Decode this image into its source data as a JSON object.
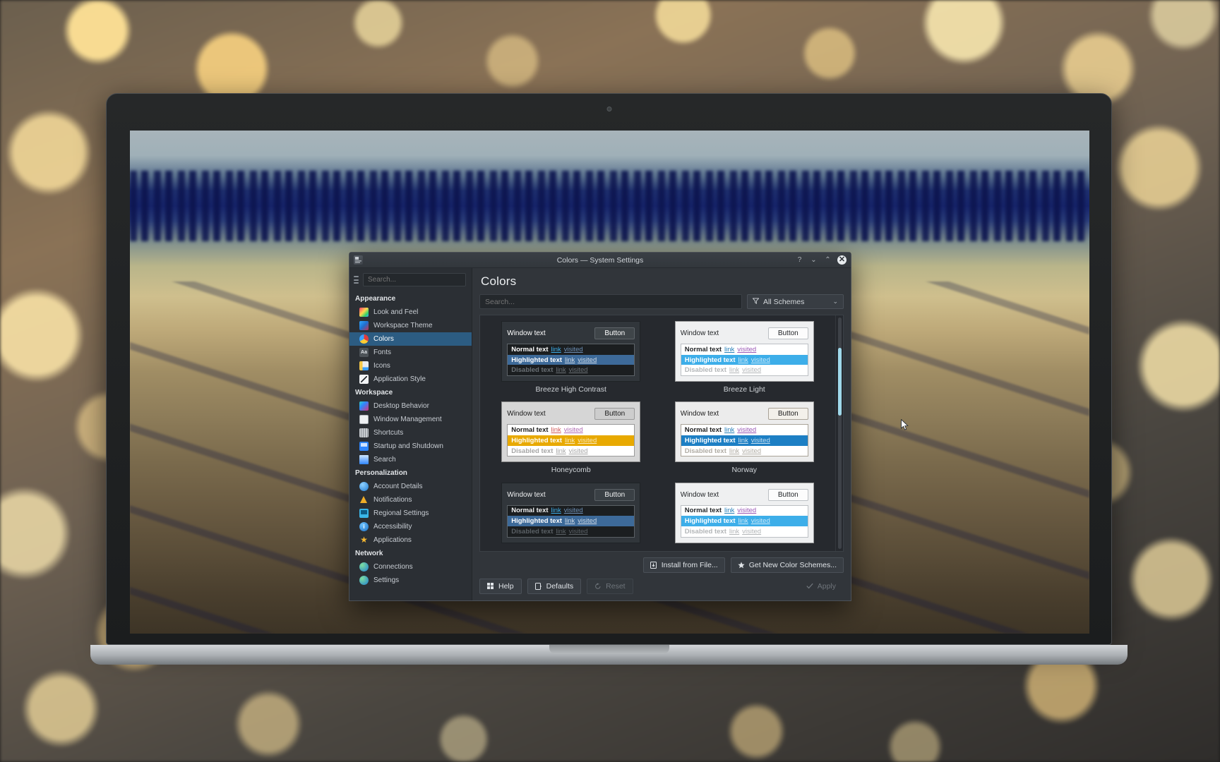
{
  "window": {
    "title": "Colors — System Settings",
    "app_icon": "system-settings-icon",
    "buttons": {
      "help": "?",
      "minimize": "⌄",
      "maximize": "⌃",
      "close": "✕"
    }
  },
  "sidebar": {
    "search_placeholder": "Search...",
    "search_value": "",
    "hamburger": "menu-icon",
    "groups": [
      {
        "label": "Appearance",
        "items": [
          {
            "label": "Look and Feel",
            "icon": "look-and-feel-icon",
            "active": false
          },
          {
            "label": "Workspace Theme",
            "icon": "workspace-theme-icon",
            "active": false
          },
          {
            "label": "Colors",
            "icon": "colors-icon",
            "active": true
          },
          {
            "label": "Fonts",
            "icon": "fonts-icon",
            "active": false
          },
          {
            "label": "Icons",
            "icon": "icons-icon",
            "active": false
          },
          {
            "label": "Application Style",
            "icon": "application-style-icon",
            "active": false
          }
        ]
      },
      {
        "label": "Workspace",
        "items": [
          {
            "label": "Desktop Behavior",
            "icon": "desktop-behavior-icon",
            "active": false
          },
          {
            "label": "Window Management",
            "icon": "window-management-icon",
            "active": false
          },
          {
            "label": "Shortcuts",
            "icon": "shortcuts-icon",
            "active": false
          },
          {
            "label": "Startup and Shutdown",
            "icon": "startup-shutdown-icon",
            "active": false
          },
          {
            "label": "Search",
            "icon": "search-module-icon",
            "active": false
          }
        ]
      },
      {
        "label": "Personalization",
        "items": [
          {
            "label": "Account Details",
            "icon": "account-details-icon",
            "active": false
          },
          {
            "label": "Notifications",
            "icon": "notifications-icon",
            "active": false
          },
          {
            "label": "Regional Settings",
            "icon": "regional-settings-icon",
            "active": false
          },
          {
            "label": "Accessibility",
            "icon": "accessibility-icon",
            "active": false
          },
          {
            "label": "Applications",
            "icon": "applications-icon",
            "active": false
          }
        ]
      },
      {
        "label": "Network",
        "items": [
          {
            "label": "Connections",
            "icon": "connections-icon",
            "active": false
          },
          {
            "label": "Settings",
            "icon": "network-settings-icon",
            "active": false
          }
        ]
      }
    ]
  },
  "main": {
    "page_title": "Colors",
    "search_placeholder": "Search...",
    "search_value": "",
    "filter": {
      "label": "All Schemes",
      "icon": "filter-funnel-icon",
      "chevron": "⌄"
    },
    "preview_labels": {
      "window_text": "Window text",
      "button": "Button",
      "normal": "Normal text",
      "highlighted": "Highlighted text",
      "disabled": "Disabled text",
      "link": "link",
      "visited": "visited"
    },
    "schemes": [
      {
        "name": "Breeze High Contrast",
        "colors": {
          "window_bg": "#31363b",
          "window_fg": "#ffffff",
          "button_bg": "#3f4549",
          "button_fg": "#ffffff",
          "button_border": "#5d6368",
          "view_bg": "#1b1e20",
          "view_border": "#5d6368",
          "normal_fg": "#ffffff",
          "highlight_bg": "#3d6a99",
          "highlight_fg": "#ffffff",
          "disabled_fg": "#6a7075",
          "link": "#3daee9",
          "visited": "#6d8fb5"
        }
      },
      {
        "name": "Breeze Light",
        "colors": {
          "window_bg": "#eff0f1",
          "window_fg": "#232629",
          "button_bg": "#fcfcfc",
          "button_fg": "#232629",
          "button_border": "#bcc0c4",
          "view_bg": "#ffffff",
          "view_border": "#bcc0c4",
          "normal_fg": "#232629",
          "highlight_bg": "#3daee9",
          "highlight_fg": "#ffffff",
          "disabled_fg": "#b3b6b8",
          "link": "#2980b9",
          "visited": "#9b59b6"
        }
      },
      {
        "name": "Honeycomb",
        "colors": {
          "window_bg": "#d6d6d6",
          "window_fg": "#1c1c1c",
          "button_bg": "#cdcdcd",
          "button_fg": "#1c1c1c",
          "button_border": "#9a9a9a",
          "view_bg": "#ffffff",
          "view_border": "#9a9a9a",
          "normal_fg": "#1c1c1c",
          "highlight_bg": "#e8a900",
          "highlight_fg": "#ffffff",
          "disabled_fg": "#a6a6a6",
          "link": "#d15b5b",
          "visited": "#b06ab3"
        }
      },
      {
        "name": "Norway",
        "colors": {
          "window_bg": "#ececec",
          "window_fg": "#1c1c1c",
          "button_bg": "#f3f0ea",
          "button_fg": "#1c1c1c",
          "button_border": "#a9a398",
          "view_bg": "#ffffff",
          "view_border": "#a9a398",
          "normal_fg": "#1c1c1c",
          "highlight_bg": "#1d7fc4",
          "highlight_fg": "#ffffff",
          "disabled_fg": "#b0aca4",
          "link": "#2980b9",
          "visited": "#9b59b6"
        }
      },
      {
        "name": "",
        "colors": {
          "window_bg": "#31363b",
          "window_fg": "#eff0f1",
          "button_bg": "#3a4045",
          "button_fg": "#eff0f1",
          "button_border": "#5a6065",
          "view_bg": "#1b1e20",
          "view_border": "#5a6065",
          "normal_fg": "#eff0f1",
          "highlight_bg": "#3d6a99",
          "highlight_fg": "#ffffff",
          "disabled_fg": "#5a6065",
          "link": "#3daee9",
          "visited": "#6d8fb5"
        }
      },
      {
        "name": "",
        "colors": {
          "window_bg": "#eff0f1",
          "window_fg": "#232629",
          "button_bg": "#fcfcfc",
          "button_fg": "#232629",
          "button_border": "#bcc0c4",
          "view_bg": "#ffffff",
          "view_border": "#bcc0c4",
          "normal_fg": "#232629",
          "highlight_bg": "#3daee9",
          "highlight_fg": "#ffffff",
          "disabled_fg": "#b3b6b8",
          "link": "#2980b9",
          "visited": "#9b59b6"
        }
      }
    ],
    "store_buttons": [
      {
        "label": "Install from File...",
        "icon": "install-file-icon"
      },
      {
        "label": "Get New Color Schemes...",
        "icon": "star-icon"
      }
    ],
    "footer_buttons": [
      {
        "label": "Help",
        "icon": "help-icon",
        "disabled": false
      },
      {
        "label": "Defaults",
        "icon": "defaults-icon",
        "disabled": false
      },
      {
        "label": "Reset",
        "icon": "reset-icon",
        "disabled": true
      }
    ],
    "apply_button": {
      "label": "Apply",
      "icon": "check-icon",
      "disabled": true
    },
    "scrollbar": {
      "thumb_color": "#9fd8ea"
    }
  }
}
